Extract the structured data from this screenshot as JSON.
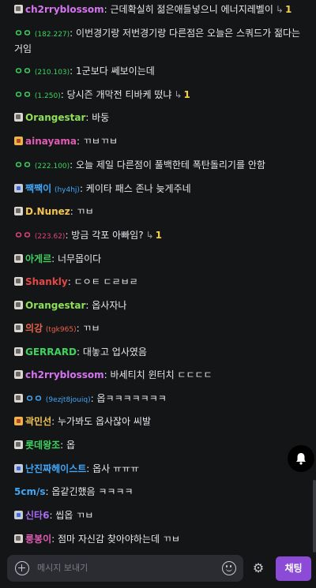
{
  "messages": [
    {
      "badge": "b1",
      "nick": "ch2rryblossom",
      "nick_color": "#d575f0",
      "sub": "",
      "text": "근데확실히 젊은애들넣으니 에너지레벨이",
      "reply": "↳",
      "reply_count": "1"
    },
    {
      "badge": "",
      "nick": "ㅇㅇ",
      "nick_color": "#3ed35f",
      "sub": "(182.227)",
      "text": "이번경기랑 저번경기랑 다른점은 오늘은 스쿼드가 젊다는 거임",
      "reply": "",
      "reply_count": ""
    },
    {
      "badge": "",
      "nick": "ㅇㅇ",
      "nick_color": "#3ed35f",
      "sub": "(210.103)",
      "text": "1군보다 쎄보이는데",
      "reply": "",
      "reply_count": ""
    },
    {
      "badge": "",
      "nick": "ㅇㅇ",
      "nick_color": "#3ed35f",
      "sub": "(1.250)",
      "text": "당시즌 개막전 티바케 떴냐",
      "reply": "↳",
      "reply_count": "1"
    },
    {
      "badge": "b1",
      "nick": "Orangestar",
      "nick_color": "#8ee05a",
      "sub": "",
      "text": "바둥",
      "reply": "",
      "reply_count": ""
    },
    {
      "badge": "b3",
      "nick": "ainayama",
      "nick_color": "#e05bb3",
      "sub": "",
      "text": "ㄲㅂㄲㅂ",
      "reply": "",
      "reply_count": ""
    },
    {
      "badge": "",
      "nick": "ㅇㅇ",
      "nick_color": "#3ed35f",
      "sub": "(222.100)",
      "text": "오늘 제일 다른점이 풀백한테 폭탄돌리기를 안함",
      "reply": "",
      "reply_count": ""
    },
    {
      "badge": "b2",
      "nick": "짹짹이",
      "nick_color": "#41a6f5",
      "sub": "(hy4hj)",
      "text": "케이타 패스 존나 늦게주네",
      "reply": "",
      "reply_count": ""
    },
    {
      "badge": "b1",
      "nick": "D.Nunez",
      "nick_color": "#f3c451",
      "sub": "",
      "text": "ㄲㅂ",
      "reply": "",
      "reply_count": ""
    },
    {
      "badge": "",
      "nick": "ㅇㅇ",
      "nick_color": "#e0457a",
      "sub": "(223.62)",
      "text": "방금 각포 아빠임?",
      "reply": "↳",
      "reply_count": "1"
    },
    {
      "badge": "b1",
      "nick": "아게르",
      "nick_color": "#3ed35f",
      "sub": "",
      "text": "너무몹이다",
      "reply": "",
      "reply_count": ""
    },
    {
      "badge": "b1",
      "nick": "Shankly",
      "nick_color": "#e24848",
      "sub": "",
      "text": "ㄷㅇㅌ ㄷㄹㅂㄹ",
      "reply": "",
      "reply_count": ""
    },
    {
      "badge": "b1",
      "nick": "Orangestar",
      "nick_color": "#8ee05a",
      "sub": "",
      "text": "옵사자나",
      "reply": "",
      "reply_count": ""
    },
    {
      "badge": "b1",
      "nick": "의강",
      "nick_color": "#e8614a",
      "sub": "(tgk965)",
      "text": "ㄲㅂ",
      "reply": "",
      "reply_count": ""
    },
    {
      "badge": "b1",
      "nick": "GERRARD",
      "nick_color": "#3ed35f",
      "sub": "",
      "text": "대놓고 업사였음",
      "reply": "",
      "reply_count": ""
    },
    {
      "badge": "b1",
      "nick": "ch2rryblossom",
      "nick_color": "#d575f0",
      "sub": "",
      "text": "바세티치 윈터치 ㄷㄷㄷㄷ",
      "reply": "",
      "reply_count": ""
    },
    {
      "badge": "b1",
      "nick": "ㅇㅇ",
      "nick_color": "#41a6f5",
      "sub": "(9ezjt8jouiq)",
      "text": "옵ㅋㅋㅋㅋㅋㅋㅋ",
      "reply": "",
      "reply_count": ""
    },
    {
      "badge": "b3",
      "nick": "곽민선",
      "nick_color": "#f3c451",
      "sub": "",
      "text": "누가봐도 옵사잖아 씨발",
      "reply": "",
      "reply_count": ""
    },
    {
      "badge": "b1",
      "nick": "롯데왕조",
      "nick_color": "#3ed35f",
      "sub": "",
      "text": "옵",
      "reply": "",
      "reply_count": ""
    },
    {
      "badge": "b2",
      "nick": "난진짜헤이스트",
      "nick_color": "#41a6f5",
      "sub": "",
      "text": "옵사 ㅠㅠㅠ",
      "reply": "",
      "reply_count": ""
    },
    {
      "badge": "",
      "nick": "5cm/s",
      "nick_color": "#41a6f5",
      "sub": "",
      "text": "옵같긴했음 ㅋㅋㅋㅋ",
      "reply": "",
      "reply_count": ""
    },
    {
      "badge": "b2",
      "nick": "신타6",
      "nick_color": "#a56cf0",
      "sub": "",
      "text": "씹옵 ㄲㅂ",
      "reply": "",
      "reply_count": ""
    },
    {
      "badge": "b1",
      "nick": "룽봉이",
      "nick_color": "#e05bb3",
      "sub": "",
      "text": "점마 자신감 찾아야하는데 ㄲㅂ",
      "reply": "",
      "reply_count": ""
    }
  ],
  "input": {
    "placeholder": "메시지 보내기"
  },
  "chat_button_label": "채팅",
  "colors": {
    "background": "#141517",
    "accent": "#8b4bd6",
    "input_bg": "#2b2c31"
  }
}
